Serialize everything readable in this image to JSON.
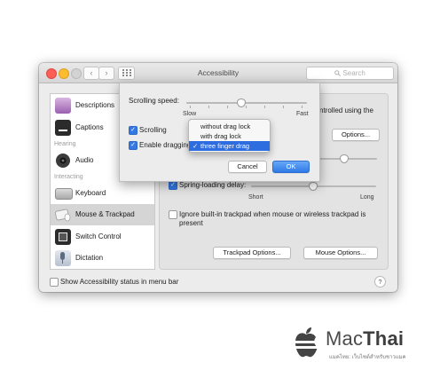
{
  "window": {
    "title": "Accessibility",
    "search_placeholder": "Search",
    "nav_back": "‹",
    "nav_forward": "›",
    "grid_icon": "grid-icon"
  },
  "sidebar": {
    "items": [
      {
        "label": "Descriptions",
        "icon": "descriptions-icon"
      },
      {
        "label": "Captions",
        "icon": "captions-icon"
      },
      {
        "label": "Audio",
        "icon": "speaker-icon"
      },
      {
        "label": "Keyboard",
        "icon": "keyboard-icon"
      },
      {
        "label": "Mouse & Trackpad",
        "icon": "mouse-icon"
      },
      {
        "label": "Switch Control",
        "icon": "switch-control-icon"
      },
      {
        "label": "Dictation",
        "icon": "microphone-icon"
      }
    ],
    "headers": {
      "hearing": "Hearing",
      "interacting": "Interacting"
    }
  },
  "pane": {
    "partial_text": "ntrolled using the",
    "options_button": "Options...",
    "spring_loading_label": "Spring-loading delay:",
    "spring_loading_checked": true,
    "short_label": "Short",
    "long_label": "Long",
    "ignore_trackpad_label": "Ignore built-in trackpad when mouse or wireless trackpad is present",
    "ignore_trackpad_checked": false,
    "trackpad_options_button": "Trackpad Options...",
    "mouse_options_button": "Mouse Options..."
  },
  "sheet": {
    "scrolling_speed_label": "Scrolling speed:",
    "slow_label": "Slow",
    "fast_label": "Fast",
    "scrolling_speed_level": 0.45,
    "scrolling_label": "Scrolling",
    "scrolling_checked": true,
    "enable_dragging_label": "Enable dragging",
    "enable_dragging_checked": true,
    "cancel_button": "Cancel",
    "ok_button": "OK"
  },
  "drag_menu": {
    "options": [
      "without drag lock",
      "with drag lock",
      "three finger drag"
    ],
    "selected": "three finger drag",
    "checkmark": "✓"
  },
  "footer": {
    "show_status_label": "Show Accessibility status in menu bar",
    "show_status_checked": false,
    "help": "?"
  },
  "logo": {
    "mac": "Mac",
    "thai": "Thai",
    "tagline": "แมคไทย: เว็บไซต์สำหรับชาวแมค"
  },
  "colors": {
    "accent": "#2d6de0",
    "ok_button": "#3a86ee",
    "close": "#fc5f57",
    "minimize": "#fdbc2e",
    "zoom": "#d3d3d3"
  }
}
